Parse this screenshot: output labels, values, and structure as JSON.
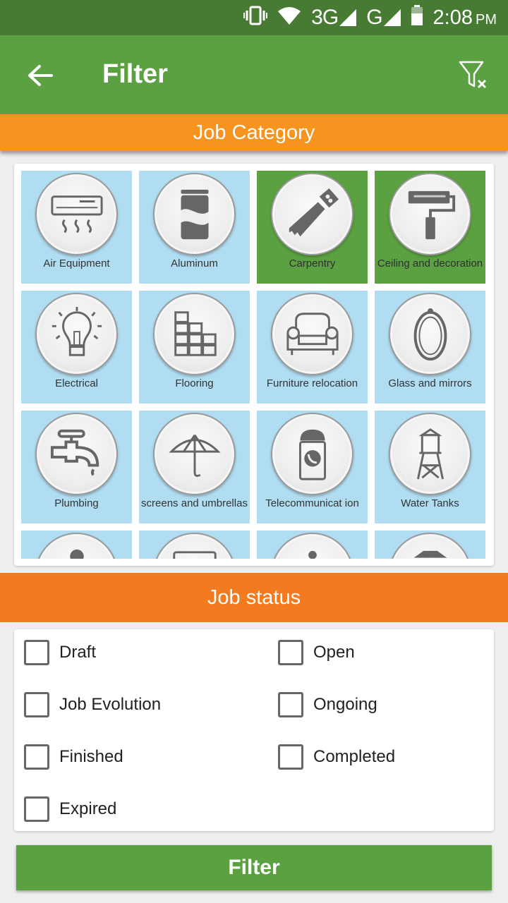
{
  "status_bar": {
    "network_3g": "3G",
    "network_g": "G",
    "time": "2:08",
    "ampm": "PM"
  },
  "app_bar": {
    "title": "Filter",
    "back_icon": "arrow-left-icon",
    "clear_icon": "filter-clear-icon"
  },
  "job_category": {
    "header": "Job Category",
    "items": [
      {
        "label": "Air Equipment",
        "icon": "air-conditioner-icon",
        "selected": false
      },
      {
        "label": "Aluminum",
        "icon": "can-icon",
        "selected": false
      },
      {
        "label": "Carpentry",
        "icon": "saw-icon",
        "selected": true
      },
      {
        "label": "Ceiling and decoration",
        "icon": "paint-roller-icon",
        "selected": true
      },
      {
        "label": "Electrical",
        "icon": "light-bulb-icon",
        "selected": false
      },
      {
        "label": "Flooring",
        "icon": "tiles-icon",
        "selected": false
      },
      {
        "label": "Furniture relocation",
        "icon": "armchair-icon",
        "selected": false
      },
      {
        "label": "Glass and mirrors",
        "icon": "mirror-icon",
        "selected": false
      },
      {
        "label": "Plumbing",
        "icon": "faucet-icon",
        "selected": false
      },
      {
        "label": "screens and umbrellas",
        "icon": "umbrella-icon",
        "selected": false
      },
      {
        "label": "Telecommunicat ion",
        "icon": "phone-booth-icon",
        "selected": false
      },
      {
        "label": "Water Tanks",
        "icon": "water-tower-icon",
        "selected": false
      },
      {
        "label": "",
        "icon": "worker-icon",
        "selected": false
      },
      {
        "label": "",
        "icon": "pipe-icon",
        "selected": false
      },
      {
        "label": "",
        "icon": "info-icon",
        "selected": false
      },
      {
        "label": "",
        "icon": "car-icon",
        "selected": false
      }
    ]
  },
  "job_status": {
    "header": "Job status",
    "options": [
      {
        "label": "Draft",
        "checked": false
      },
      {
        "label": "Open",
        "checked": false
      },
      {
        "label": "Job Evolution",
        "checked": false
      },
      {
        "label": "Ongoing",
        "checked": false
      },
      {
        "label": "Finished",
        "checked": false
      },
      {
        "label": "Completed",
        "checked": false
      },
      {
        "label": "Expired",
        "checked": false
      }
    ]
  },
  "filter_button": {
    "label": "Filter"
  },
  "colors": {
    "primary": "#5ba142",
    "primary_dark": "#477b33",
    "accent": "#f7941f",
    "tile": "#b0ddf2"
  }
}
